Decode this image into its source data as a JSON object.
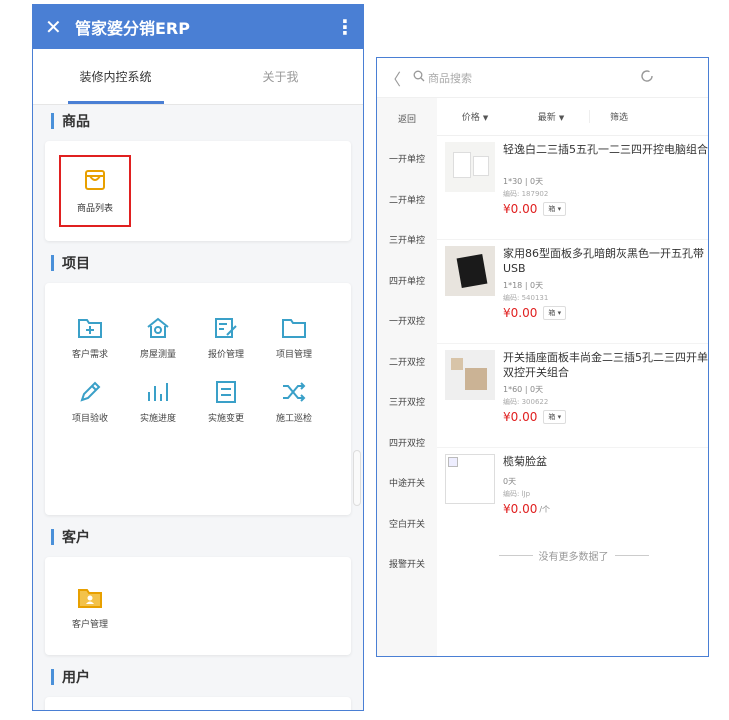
{
  "left": {
    "header": {
      "close": "✕",
      "title": "管家婆分销ERP",
      "more": "⋮"
    },
    "tabs": [
      {
        "label": "装修内控系统"
      },
      {
        "label": "关于我"
      }
    ],
    "sections": {
      "goods": {
        "title": "商品",
        "items": [
          {
            "label": "商品列表",
            "icon": "shopping-bag-icon"
          }
        ]
      },
      "project": {
        "title": "项目",
        "items": [
          {
            "label": "客户需求",
            "icon": "folder-plus-icon"
          },
          {
            "label": "房屋测量",
            "icon": "house-icon"
          },
          {
            "label": "报价管理",
            "icon": "edit-document-icon"
          },
          {
            "label": "项目管理",
            "icon": "folder-icon"
          },
          {
            "label": "项目验收",
            "icon": "pencil-icon"
          },
          {
            "label": "实施进度",
            "icon": "bar-chart-icon"
          },
          {
            "label": "实施变更",
            "icon": "note-icon"
          },
          {
            "label": "施工巡检",
            "icon": "shuffle-icon"
          }
        ]
      },
      "customer": {
        "title": "客户",
        "items": [
          {
            "label": "客户管理",
            "icon": "contact-card-icon"
          }
        ]
      },
      "user": {
        "title": "用户"
      }
    }
  },
  "right": {
    "search": {
      "back": "〈",
      "placeholder": "商品搜索"
    },
    "categories": [
      "返回",
      "一开单控",
      "二开单控",
      "三开单控",
      "四开单控",
      "一开双控",
      "二开双控",
      "三开双控",
      "四开双控",
      "中途开关",
      "空白开关",
      "报警开关"
    ],
    "sort": [
      {
        "label": "价格"
      },
      {
        "label": "最新"
      },
      {
        "label": "筛选"
      }
    ],
    "products": [
      {
        "name": "轻逸白二三插5五孔一二三四开控电脑组合",
        "spec": "1*30 | 0天",
        "code": "编码: 187902",
        "price": "¥0.00",
        "unit": "箱"
      },
      {
        "name": "家用86型面板多孔暗朗灰黑色一开五孔带USB",
        "spec": "1*18 | 0天",
        "code": "编码: 540131",
        "price": "¥0.00",
        "unit": "箱"
      },
      {
        "name": "开关插座面板丰尚金二三插5孔二三四开单双控开关组合",
        "spec": "1*60 | 0天",
        "code": "编码: 300622",
        "price": "¥0.00",
        "unit": "箱"
      },
      {
        "name": "榄菊脸盆",
        "spec": "0天",
        "code": "编码: lJp",
        "price": "¥0.00",
        "unit_text": "/个"
      }
    ],
    "no_more": "没有更多数据了"
  },
  "colors": {
    "primary": "#4a7fd4",
    "price": "#e02020",
    "icon_teal": "#3aa0c8",
    "icon_orange": "#e8a000"
  }
}
